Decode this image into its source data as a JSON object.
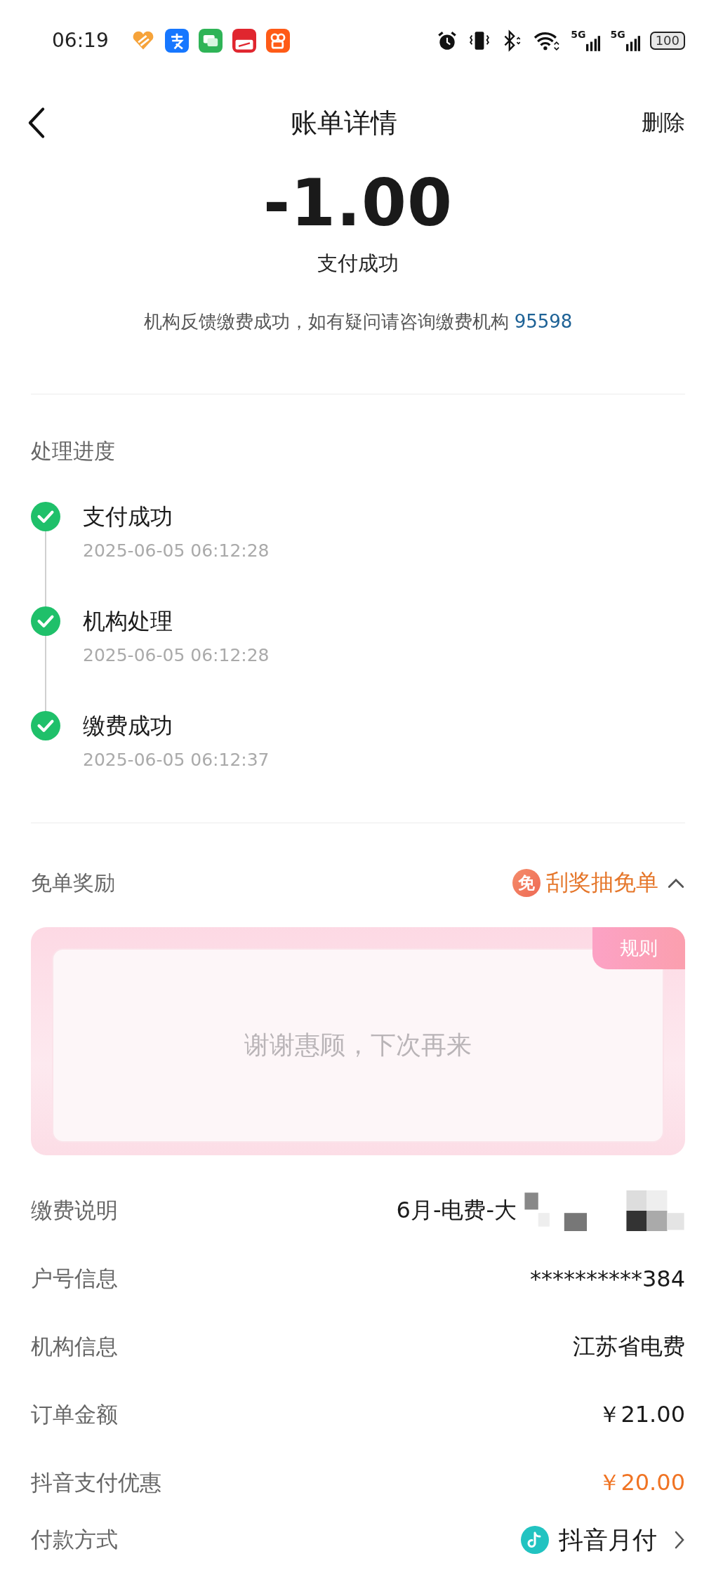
{
  "status_bar": {
    "time": "06:19",
    "networks": [
      "5G",
      "5G"
    ],
    "battery": "100"
  },
  "header": {
    "title": "账单详情",
    "action": "删除"
  },
  "summary": {
    "amount": "-1.00",
    "status": "支付成功",
    "note": "机构反馈缴费成功，如有疑问请咨询缴费机构",
    "link": "95598"
  },
  "progress": {
    "title": "处理进度",
    "steps": [
      {
        "label": "支付成功",
        "time": "2025-06-05 06:12:28",
        "done": true
      },
      {
        "label": "机构处理",
        "time": "2025-06-05 06:12:28",
        "done": true
      },
      {
        "label": "缴费成功",
        "time": "2025-06-05 06:12:37",
        "done": true
      }
    ]
  },
  "reward": {
    "title": "免单奖励",
    "badge": "免",
    "action": "刮奖抽免单",
    "expanded": true,
    "rules": "规则",
    "message": "谢谢惠顾，下次再来"
  },
  "details": [
    {
      "kind": "redacted",
      "label": "缴费说明",
      "value": "6月-电费-大"
    },
    {
      "kind": "plain",
      "label": "户号信息",
      "value": "**********384"
    },
    {
      "kind": "plain",
      "label": "机构信息",
      "value": "江苏省电费"
    },
    {
      "kind": "plain",
      "label": "订单金额",
      "value": "￥21.00"
    },
    {
      "kind": "discount",
      "label": "抖音支付优惠",
      "value": "￥20.00"
    },
    {
      "kind": "payment",
      "label": "付款方式",
      "value": "抖音月付"
    }
  ]
}
